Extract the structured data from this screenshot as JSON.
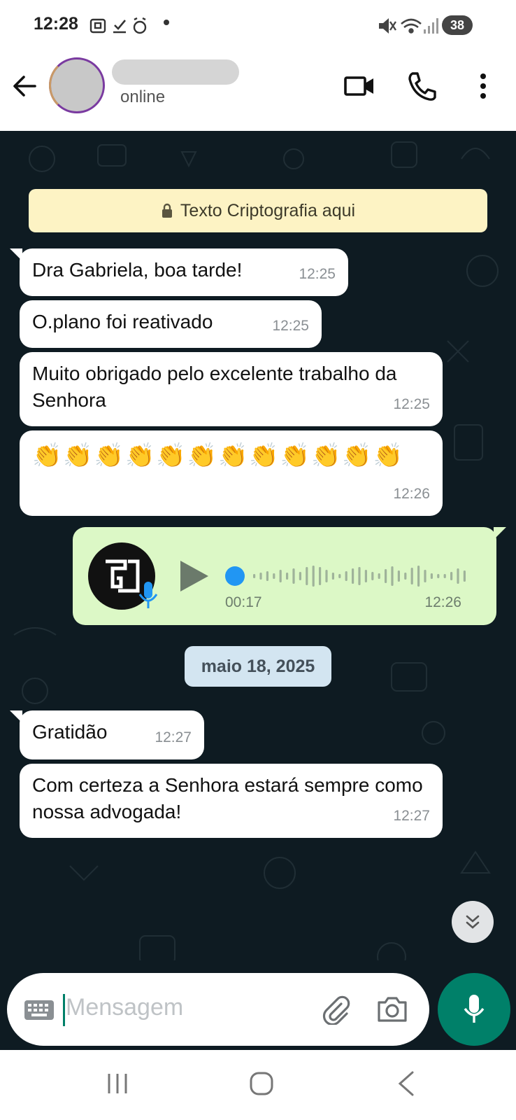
{
  "status_bar": {
    "time": "12:28",
    "battery": "38",
    "left_icons": [
      "screenshot-icon",
      "check-icon",
      "alarm-icon",
      "dot"
    ],
    "right_icons": [
      "mute-icon",
      "wifi-icon",
      "signal-icon"
    ]
  },
  "header": {
    "presence": "online",
    "actions": [
      "video-call-icon",
      "voice-call-icon",
      "more-options-icon"
    ]
  },
  "chat": {
    "encryption_notice": "Texto Criptografia aqui",
    "messages": [
      {
        "text": "Dra Gabriela, boa tarde!",
        "time": "12:25",
        "direction": "incoming"
      },
      {
        "text": "O.plano foi reativado",
        "time": "12:25",
        "direction": "incoming"
      },
      {
        "text": "Muito obrigado pelo excelente trabalho da Senhora",
        "time": "12:25",
        "direction": "incoming"
      },
      {
        "text": "👏👏👏👏👏👏👏👏👏👏👏👏",
        "time": "12:26",
        "direction": "incoming"
      }
    ],
    "voice_message": {
      "duration": "00:17",
      "time": "12:26",
      "direction": "outgoing",
      "progress": 0
    },
    "date_chip": "maio 18, 2025",
    "messages_after": [
      {
        "text": "Gratidão",
        "time": "12:27",
        "direction": "incoming"
      },
      {
        "text": "Com certeza a Senhora estará sempre como nossa advogada!",
        "time": "12:27",
        "direction": "incoming"
      }
    ]
  },
  "composer": {
    "placeholder": "Mensagem"
  },
  "colors": {
    "accent": "#008069",
    "chat_bg": "#0e1b22",
    "outgoing_bubble": "#dcf8c6",
    "incoming_bubble": "#ffffff",
    "notice_bg": "#fdf3c4",
    "date_chip_bg": "#d3e5f1"
  }
}
